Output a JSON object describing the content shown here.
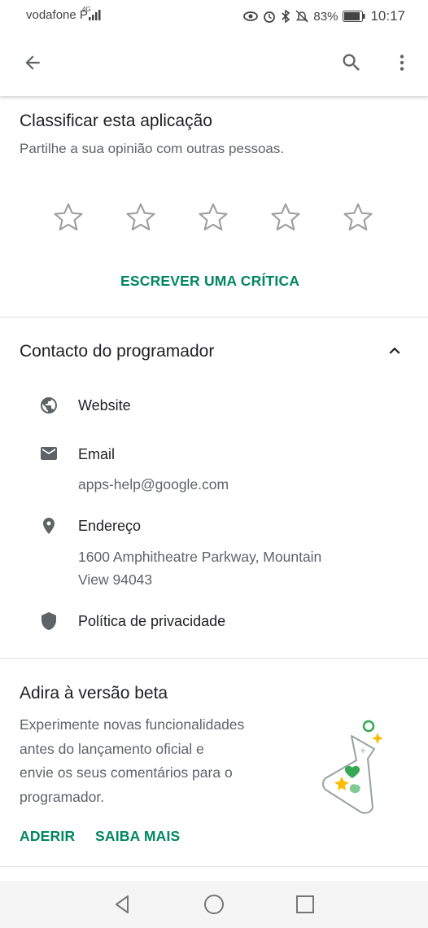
{
  "status_bar": {
    "carrier": "vodafone P",
    "network": "4G",
    "battery": "83%",
    "time": "10:17"
  },
  "rating": {
    "title": "Classificar esta aplicação",
    "subtitle": "Partilhe a sua opinião com outras pessoas.",
    "stars_total": 5,
    "stars_filled": 0,
    "write_review": "ESCREVER UMA CRÍTICA"
  },
  "developer_contact": {
    "title": "Contacto do programador",
    "items": [
      {
        "label": "Website",
        "icon": "globe-icon"
      },
      {
        "label": "Email",
        "value": "apps-help@google.com",
        "icon": "email-icon"
      },
      {
        "label": "Endereço",
        "value_lines": [
          "1600 Amphitheatre Parkway, Mountain",
          "View 94043"
        ],
        "icon": "location-pin-icon"
      },
      {
        "label": "Política de privacidade",
        "icon": "shield-icon"
      }
    ]
  },
  "beta": {
    "title": "Adira à versão beta",
    "description_lines": [
      "Experimente novas funcionalidades",
      "antes do lançamento oficial e",
      "envie os seus comentários para o",
      "programador."
    ],
    "join": "ADERIR",
    "learn_more": "SAIBA MAIS"
  },
  "colors": {
    "accent": "#01875f",
    "text_primary": "#202124",
    "text_secondary": "#5f6368"
  }
}
